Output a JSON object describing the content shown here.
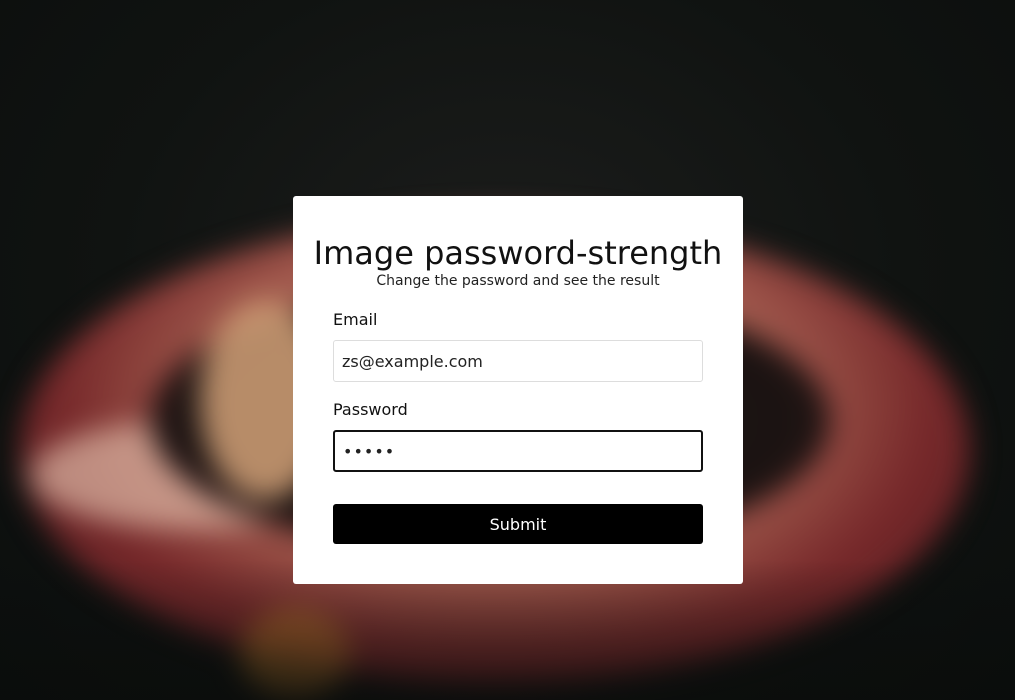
{
  "form": {
    "title": "Image password-strength",
    "subtitle": "Change the password and see the result",
    "email_label": "Email",
    "email_value": "zs@example.com",
    "password_label": "Password",
    "password_value": "•••••",
    "submit_label": "Submit"
  },
  "colors": {
    "card_background": "#ffffff",
    "button_background": "#000000",
    "button_text": "#ffffff",
    "focused_border": "#111111"
  }
}
